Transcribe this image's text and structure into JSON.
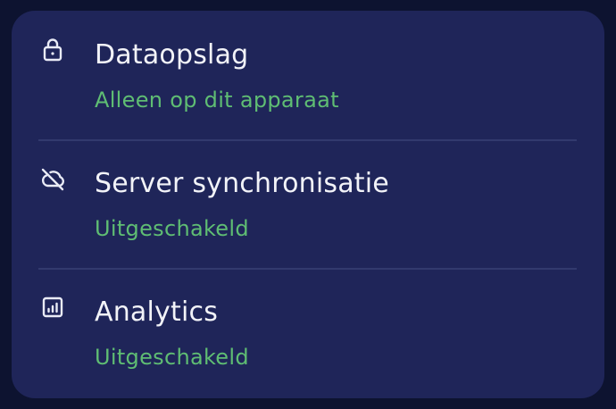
{
  "settings": {
    "items": [
      {
        "icon": "lock-icon",
        "label": "Dataopslag",
        "value": "Alleen op dit apparaat"
      },
      {
        "icon": "cloud-off-icon",
        "label": "Server synchronisatie",
        "value": "Uitgeschakeld"
      },
      {
        "icon": "analytics-icon",
        "label": "Analytics",
        "value": "Uitgeschakeld"
      }
    ]
  },
  "colors": {
    "background": "#0d1330",
    "card": "#1f2559",
    "text": "#f2f3f8",
    "accent": "#5fbd73",
    "divider": "#323a6e"
  }
}
